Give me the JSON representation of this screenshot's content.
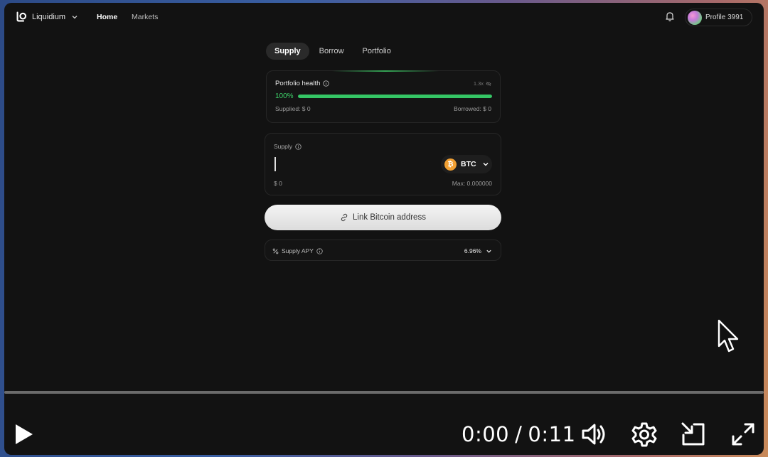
{
  "nav": {
    "brand": "Liquidium",
    "home": "Home",
    "markets": "Markets",
    "profile": "Profile 3991"
  },
  "tabs": [
    {
      "label": "Supply",
      "active": true
    },
    {
      "label": "Borrow",
      "active": false
    },
    {
      "label": "Portfolio",
      "active": false
    }
  ],
  "health": {
    "title": "Portfolio health",
    "currency_toggle": "1.3x",
    "percent": "100%",
    "level": 1.0,
    "supplied": "Supplied: $ 0",
    "borrowed": "Borrowed: $ 0"
  },
  "supply": {
    "label": "Supply",
    "value": "",
    "token": "BTC",
    "token_icon": "₿",
    "usd": "$ 0",
    "max": "Max: 0.000000"
  },
  "link_button": "Link Bitcoin address",
  "apy": {
    "label": "Supply APY",
    "value": "6.96%"
  },
  "video": {
    "current": "0:00",
    "separator": "/",
    "duration": "0:11",
    "progress": 0
  },
  "colors": {
    "accent_green": "#35c665",
    "btc_orange": "#f2a033",
    "background": "#121212"
  }
}
